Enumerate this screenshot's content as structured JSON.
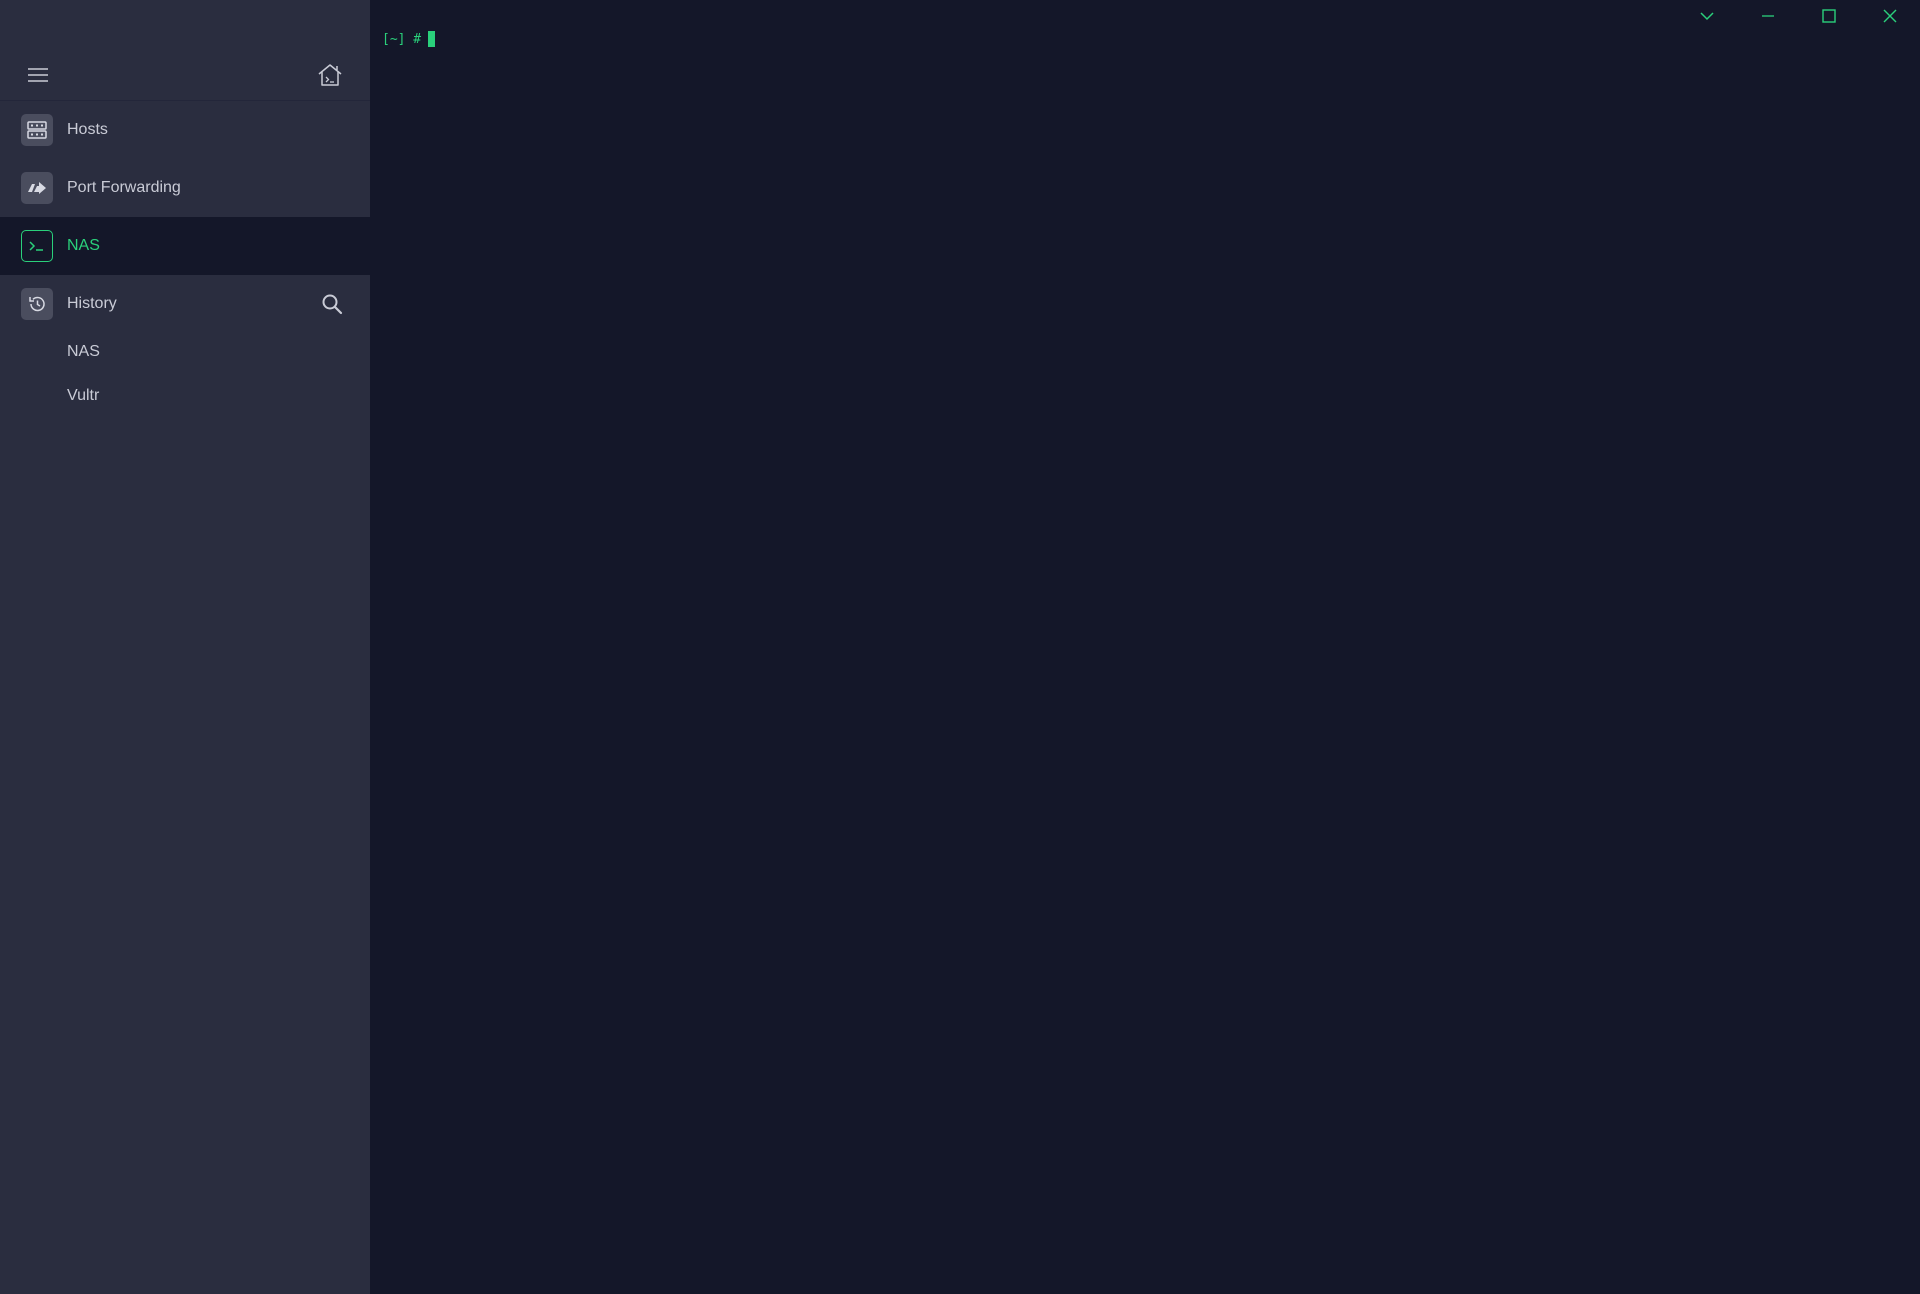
{
  "sidebar": {
    "nav": [
      {
        "label": "Hosts",
        "icon": "hosts-grid-icon"
      },
      {
        "label": "Port Forwarding",
        "icon": "port-forwarding-icon"
      },
      {
        "label": "NAS",
        "icon": "terminal-icon",
        "active": true
      }
    ],
    "history": {
      "label": "History",
      "items": [
        {
          "label": "NAS"
        },
        {
          "label": "Vultr"
        }
      ]
    }
  },
  "terminal": {
    "prompt": "[~] #"
  },
  "colors": {
    "accent": "#2ad07b",
    "sidebar_bg": "#2a2d3f",
    "terminal_bg": "#141729",
    "text": "#c9cbd6"
  }
}
